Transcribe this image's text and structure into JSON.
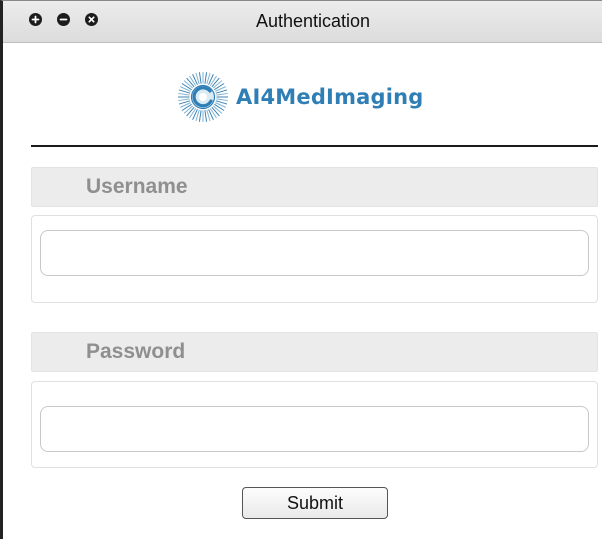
{
  "window": {
    "title": "Authentication",
    "controls": [
      "maximize-icon",
      "minimize-icon",
      "close-icon"
    ]
  },
  "logo": {
    "text": "AI4MedImaging",
    "color": "#2f7fb6",
    "icon": "radial-sunburst-logo-icon"
  },
  "form": {
    "username": {
      "label": "Username",
      "value": "",
      "placeholder": ""
    },
    "password": {
      "label": "Password",
      "value": "",
      "placeholder": ""
    },
    "submit_label": "Submit"
  },
  "colors": {
    "label_bg": "#ececec",
    "label_text": "#8f8f8f",
    "title_bar": "#e4e4e4",
    "divider": "#1a1a1a"
  }
}
